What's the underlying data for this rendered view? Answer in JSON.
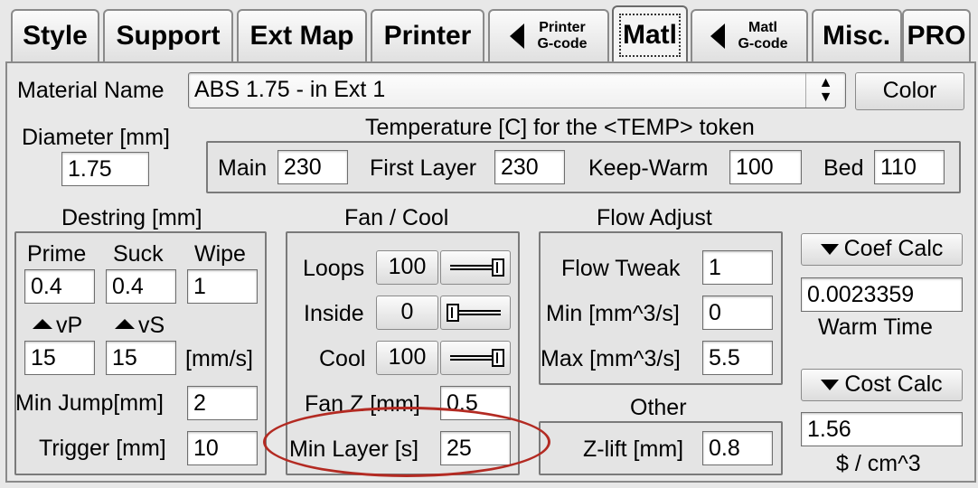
{
  "tabs": [
    {
      "label": "Style"
    },
    {
      "label": "Support"
    },
    {
      "label": "Ext Map"
    },
    {
      "label": "Printer"
    },
    {
      "label_line1": "Printer",
      "label_line2": "G-code"
    },
    {
      "label": "Matl"
    },
    {
      "label_line1": "Matl",
      "label_line2": "G-code"
    },
    {
      "label": "Misc."
    },
    {
      "label": "PRO"
    }
  ],
  "material": {
    "name_label": "Material Name",
    "name_value": "ABS 1.75 - in Ext 1",
    "color_button": "Color",
    "diameter_label": "Diameter [mm]",
    "diameter_value": "1.75"
  },
  "temperature": {
    "title": "Temperature [C] for the <TEMP> token",
    "main_label": "Main",
    "main_value": "230",
    "first_layer_label": "First Layer",
    "first_layer_value": "230",
    "keep_warm_label": "Keep-Warm",
    "keep_warm_value": "100",
    "bed_label": "Bed",
    "bed_value": "110"
  },
  "destring": {
    "title": "Destring [mm]",
    "prime_label": "Prime",
    "prime_value": "0.4",
    "suck_label": "Suck",
    "suck_value": "0.4",
    "wipe_label": "Wipe",
    "wipe_value": "1",
    "vp_label": "vP",
    "vp_value": "15",
    "vs_label": "vS",
    "vs_value": "15",
    "speed_unit": "[mm/s]",
    "min_jump_label": "Min Jump[mm]",
    "min_jump_value": "2",
    "trigger_label": "Trigger [mm]",
    "trigger_value": "10"
  },
  "fan": {
    "title": "Fan / Cool",
    "loops_label": "Loops",
    "loops_value": "100",
    "inside_label": "Inside",
    "inside_value": "0",
    "cool_label": "Cool",
    "cool_value": "100",
    "fan_z_label": "Fan Z [mm]",
    "fan_z_value": "0.5",
    "min_layer_label": "Min Layer [s]",
    "min_layer_value": "25"
  },
  "flow": {
    "title": "Flow Adjust",
    "tweak_label": "Flow Tweak",
    "tweak_value": "1",
    "min_label": "Min [mm^3/s]",
    "min_value": "0",
    "max_label": "Max [mm^3/s]",
    "max_value": "5.5"
  },
  "other": {
    "title": "Other",
    "zlift_label": "Z-lift [mm]",
    "zlift_value": "0.8"
  },
  "coef": {
    "button": "Coef Calc",
    "value": "0.0023359",
    "caption": "Warm Time"
  },
  "cost": {
    "button": "Cost Calc",
    "value": "1.56",
    "caption": "$ / cm^3"
  },
  "colors": {
    "highlight": "#b32a22"
  }
}
